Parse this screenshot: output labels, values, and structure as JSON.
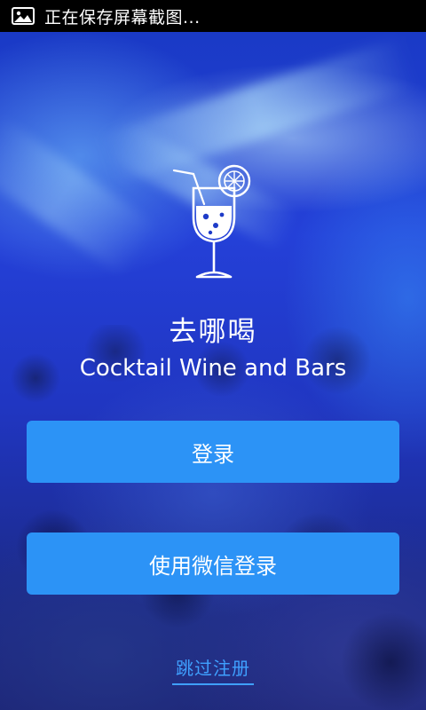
{
  "status_bar": {
    "icon": "image-icon",
    "text": "正在保存屏幕截图..."
  },
  "app": {
    "logo_icon": "cocktail-glass-icon",
    "title": "去哪喝",
    "subtitle": "Cocktail Wine and Bars"
  },
  "actions": {
    "login_label": "登录",
    "wechat_login_label": "使用微信登录",
    "skip_label": "跳过注册"
  },
  "colors": {
    "button": "#2c93f6",
    "link": "#3fa0ff",
    "status_bar": "#000000"
  }
}
